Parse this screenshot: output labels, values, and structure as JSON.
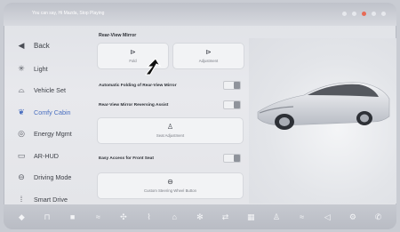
{
  "status_bar": {
    "voice_hint": "You can say, Hi Mazda, Stop Playing"
  },
  "sidebar": {
    "back_label": "Back",
    "items": [
      {
        "label": "Light",
        "icon": "light-icon"
      },
      {
        "label": "Vehicle Set",
        "icon": "car-outline-icon"
      },
      {
        "label": "Comfy Cabin",
        "icon": "seat-icon",
        "active": true
      },
      {
        "label": "Energy Mgmt",
        "icon": "energy-icon"
      },
      {
        "label": "AR-HUD",
        "icon": "hud-icon"
      },
      {
        "label": "Driving Mode",
        "icon": "steering-icon"
      },
      {
        "label": "Smart Drive",
        "icon": "smart-drive-icon"
      }
    ]
  },
  "main": {
    "section_title": "Rear-View Mirror",
    "mirror_buttons": [
      {
        "label": "Fold",
        "icon": "mirror-fold-icon"
      },
      {
        "label": "Adjustment",
        "icon": "mirror-adjust-icon"
      }
    ],
    "auto_fold_label": "Automatic Folding of Rear-View Mirror",
    "reversing_assist_label": "Rear-View Mirror Reversing Assist",
    "seat_adjustment_label": "Seat Adjustment",
    "easy_access_label": "Easy Access for Front Seat",
    "steering_button_label": "Custom Steering Wheel Button"
  },
  "colors": {
    "accent": "#4a6fc0",
    "background": "#e3e4e8"
  }
}
